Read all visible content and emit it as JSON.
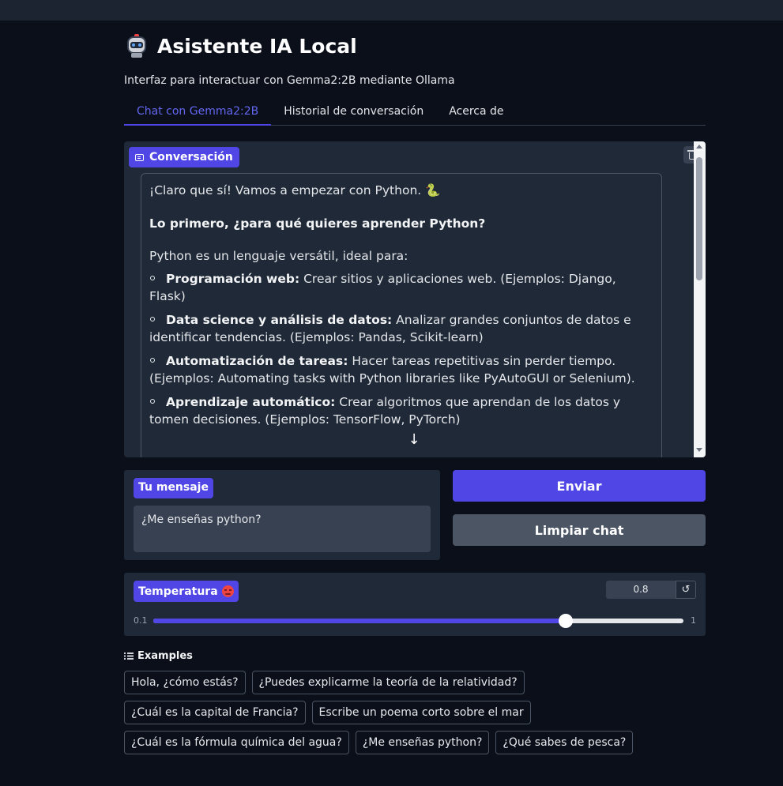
{
  "app": {
    "title": "Asistente IA Local",
    "subtitle": "Interfaz para interactuar con Gemma2:2B mediante Ollama"
  },
  "tabs": [
    {
      "label": "Chat con Gemma2:2B",
      "active": true
    },
    {
      "label": "Historial de conversación",
      "active": false
    },
    {
      "label": "Acerca de",
      "active": false
    }
  ],
  "chat": {
    "label": "Conversación",
    "message": {
      "intro": "¡Claro que sí! Vamos a empezar con Python. 🐍",
      "question": "Lo primero, ¿para qué quieres aprender Python?",
      "lead": "Python es un lenguaje versátil, ideal para:",
      "items": [
        {
          "bold": "Programación web:",
          "text": " Crear sitios y aplicaciones web. (Ejemplos: Django, Flask)"
        },
        {
          "bold": "Data science y análisis de datos:",
          "text": " Analizar grandes conjuntos de datos e identificar tendencias. (Ejemplos: Pandas, Scikit-learn)"
        },
        {
          "bold": "Automatización de tareas:",
          "text": " Hacer tareas repetitivas sin perder tiempo. (Ejemplos: Automating tasks with Python libraries like PyAutoGUI or Selenium)."
        },
        {
          "bold": "Aprendizaje automático:",
          "text": " Crear algoritmos que aprendan de los datos y tomen decisiones. (Ejemplos: TensorFlow, PyTorch)"
        }
      ]
    },
    "scroll_down_glyph": "↓"
  },
  "input": {
    "label": "Tu mensaje",
    "value": "¿Me enseñas python?"
  },
  "buttons": {
    "send": "Enviar",
    "clear": "Limpiar chat"
  },
  "temperature": {
    "label": "Temperatura",
    "value": "0.8",
    "numeric": 0.8,
    "min": "0.1",
    "max": "1",
    "min_num": 0.1,
    "max_num": 1,
    "reset_glyph": "↺"
  },
  "examples": {
    "heading": "Examples",
    "rows": [
      [
        "Hola, ¿cómo estás?",
        "¿Puedes explicarme la teoría de la relatividad?"
      ],
      [
        "¿Cuál es la capital de Francia?",
        "Escribe un poema corto sobre el mar"
      ],
      [
        "¿Cuál es la fórmula química del agua?",
        "¿Me enseñas python?",
        "¿Qué sabes de pesca?"
      ]
    ]
  },
  "colors": {
    "accent": "#4f46e5",
    "background": "#0b0f19",
    "panel": "#1f2937"
  }
}
